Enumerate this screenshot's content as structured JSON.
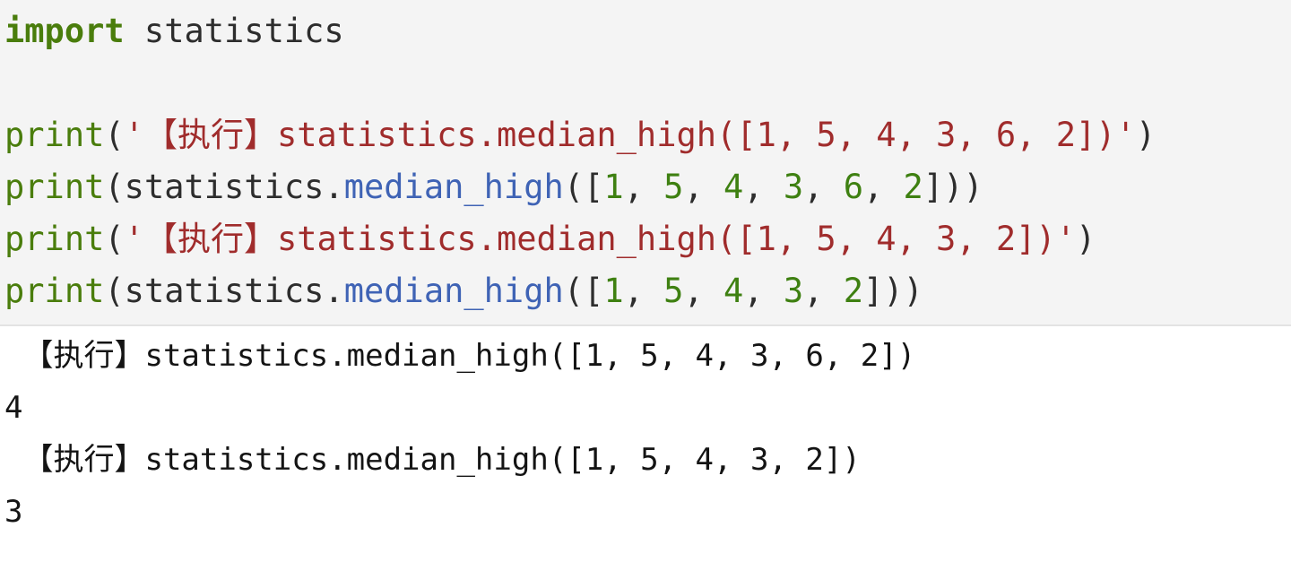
{
  "notebook": {
    "cell": {
      "language": "python",
      "background_color": "#f4f4f4",
      "lines": [
        {
          "id": "line-1",
          "tokens": [
            {
              "type": "kw",
              "text": "import"
            },
            {
              "type": "plain",
              "text": " statistics"
            }
          ]
        },
        {
          "id": "line-2",
          "tokens": []
        },
        {
          "id": "line-3",
          "tokens": [
            {
              "type": "builtin",
              "text": "print"
            },
            {
              "type": "punc",
              "text": "("
            },
            {
              "type": "str",
              "text": "'【执行】statistics.median_high([1, 5, 4, 3, 6, 2])'"
            },
            {
              "type": "punc",
              "text": ")"
            }
          ]
        },
        {
          "id": "line-4",
          "tokens": [
            {
              "type": "builtin",
              "text": "print"
            },
            {
              "type": "punc",
              "text": "("
            },
            {
              "type": "plain",
              "text": "statistics."
            },
            {
              "type": "func",
              "text": "median_high"
            },
            {
              "type": "punc",
              "text": "(["
            },
            {
              "type": "num",
              "text": "1"
            },
            {
              "type": "punc",
              "text": ", "
            },
            {
              "type": "num",
              "text": "5"
            },
            {
              "type": "punc",
              "text": ", "
            },
            {
              "type": "num",
              "text": "4"
            },
            {
              "type": "punc",
              "text": ", "
            },
            {
              "type": "num",
              "text": "3"
            },
            {
              "type": "punc",
              "text": ", "
            },
            {
              "type": "num",
              "text": "6"
            },
            {
              "type": "punc",
              "text": ", "
            },
            {
              "type": "num",
              "text": "2"
            },
            {
              "type": "punc",
              "text": "]))"
            }
          ]
        },
        {
          "id": "line-5",
          "tokens": [
            {
              "type": "builtin",
              "text": "print"
            },
            {
              "type": "punc",
              "text": "("
            },
            {
              "type": "str",
              "text": "'【执行】statistics.median_high([1, 5, 4, 3, 2])'"
            },
            {
              "type": "punc",
              "text": ")"
            }
          ]
        },
        {
          "id": "line-6",
          "tokens": [
            {
              "type": "builtin",
              "text": "print"
            },
            {
              "type": "punc",
              "text": "("
            },
            {
              "type": "plain",
              "text": "statistics."
            },
            {
              "type": "func",
              "text": "median_high"
            },
            {
              "type": "punc",
              "text": "(["
            },
            {
              "type": "num",
              "text": "1"
            },
            {
              "type": "punc",
              "text": ", "
            },
            {
              "type": "num",
              "text": "5"
            },
            {
              "type": "punc",
              "text": ", "
            },
            {
              "type": "num",
              "text": "4"
            },
            {
              "type": "punc",
              "text": ", "
            },
            {
              "type": "num",
              "text": "3"
            },
            {
              "type": "punc",
              "text": ", "
            },
            {
              "type": "num",
              "text": "2"
            },
            {
              "type": "punc",
              "text": "]))"
            }
          ]
        }
      ]
    },
    "output": {
      "lines": [
        " 【执行】statistics.median_high([1, 5, 4, 3, 6, 2])",
        "4",
        " 【执行】statistics.median_high([1, 5, 4, 3, 2])",
        "3"
      ]
    }
  },
  "colors": {
    "keyword": "#4a7d0c",
    "builtin": "#4a7d0c",
    "string": "#a02c2c",
    "function": "#3f63b5",
    "number": "#3e8011",
    "punctuation": "#2d2d2d",
    "code_background": "#f4f4f4",
    "output_text": "#141414",
    "output_background": "#ffffff"
  }
}
